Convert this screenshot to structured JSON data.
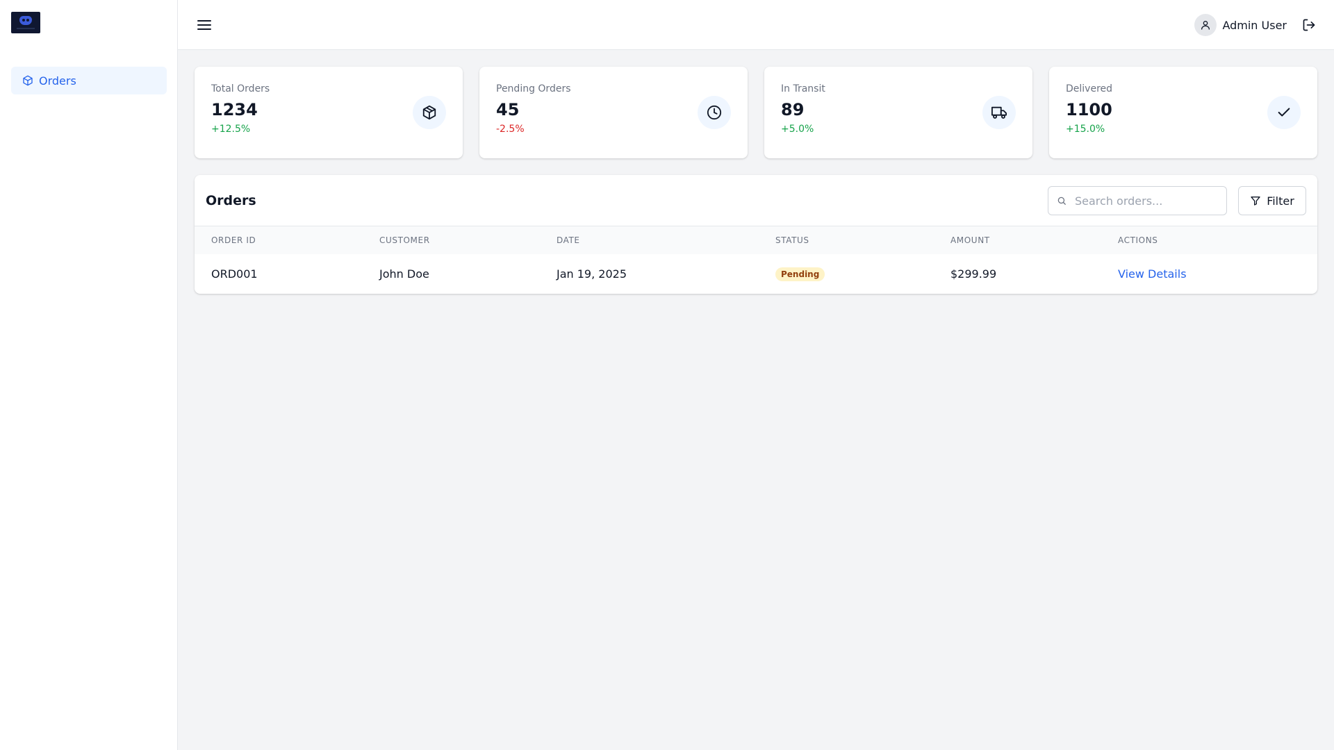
{
  "sidebar": {
    "items": [
      {
        "label": "Orders",
        "icon": "cube-icon",
        "active": true
      }
    ]
  },
  "header": {
    "user_name": "Admin User"
  },
  "stats": [
    {
      "label": "Total Orders",
      "value": "1234",
      "change": "+12.5%",
      "trend": "up",
      "icon": "cube-icon"
    },
    {
      "label": "Pending Orders",
      "value": "45",
      "change": "-2.5%",
      "trend": "down",
      "icon": "clock-icon"
    },
    {
      "label": "In Transit",
      "value": "89",
      "change": "+5.0%",
      "trend": "up",
      "icon": "truck-icon"
    },
    {
      "label": "Delivered",
      "value": "1100",
      "change": "+15.0%",
      "trend": "up",
      "icon": "check-icon"
    }
  ],
  "orders": {
    "title": "Orders",
    "search_placeholder": "Search orders...",
    "filter_label": "Filter",
    "columns": [
      "ORDER ID",
      "CUSTOMER",
      "DATE",
      "STATUS",
      "AMOUNT",
      "ACTIONS"
    ],
    "rows": [
      {
        "order_id": "ORD001",
        "customer": "John Doe",
        "date": "Jan 19, 2025",
        "status": "Pending",
        "amount": "$299.99",
        "action": "View Details"
      }
    ]
  },
  "colors": {
    "accent": "#2563eb",
    "positive": "#16a34a",
    "negative": "#dc2626",
    "pending_badge_bg": "#fef3c7",
    "pending_badge_text": "#92400e"
  }
}
